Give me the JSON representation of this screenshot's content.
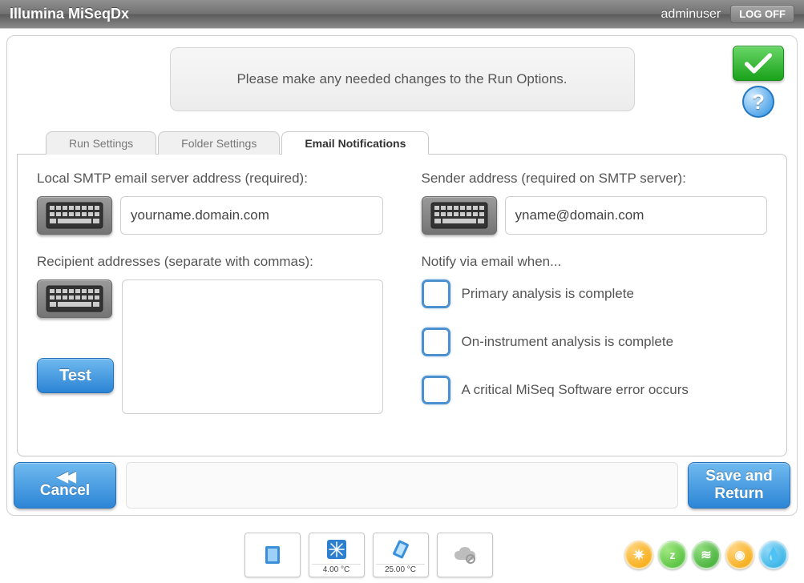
{
  "header": {
    "title": "Illumina MiSeqDx",
    "user": "adminuser",
    "logoff": "LOG OFF"
  },
  "info_text": "Please make any needed changes to the Run Options.",
  "tabs": {
    "run_settings": "Run Settings",
    "folder_settings": "Folder Settings",
    "email_notifications": "Email Notifications"
  },
  "form": {
    "smtp_label": "Local SMTP email server address (required):",
    "smtp_value": "yourname.domain.com",
    "sender_label": "Sender address (required on SMTP server):",
    "sender_value": "yname@domain.com",
    "recipients_label": "Recipient addresses (separate with commas):",
    "recipients_value": "",
    "test_label": "Test",
    "notify_label": "Notify via email when...",
    "cb_primary": "Primary analysis is complete",
    "cb_instrument": "On-instrument analysis is complete",
    "cb_error": "A critical MiSeq Software error occurs"
  },
  "buttons": {
    "cancel": "Cancel",
    "save_line1": "Save and",
    "save_line2": "Return"
  },
  "status": {
    "temp1": "4.00 °C",
    "temp2": "25.00 °C"
  }
}
